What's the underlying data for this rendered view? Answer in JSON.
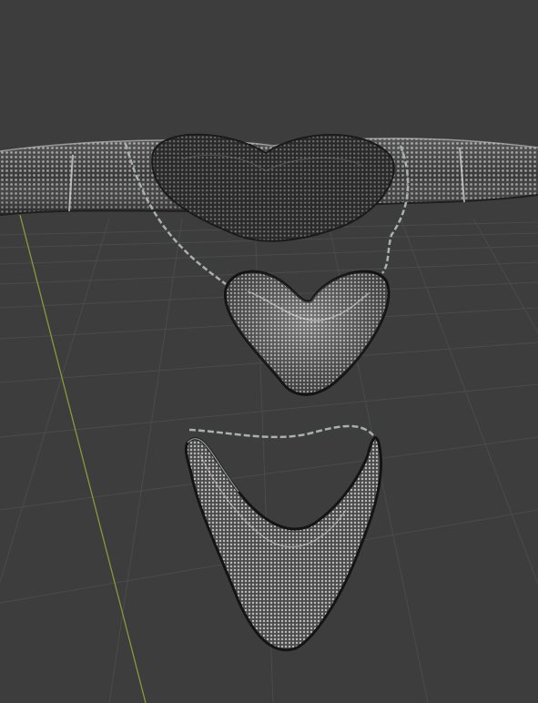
{
  "viewport": {
    "background_color": "#3d3d3d",
    "grid_color": "#4b4b4b",
    "y_axis_color": "#8a9a3a"
  },
  "scene": {
    "objects": [
      {
        "name": "mesh-strap",
        "color": "#8f8f8f"
      },
      {
        "name": "mesh-heart-bra-cup",
        "color": "#5a5a5a"
      },
      {
        "name": "mesh-heart-pendant",
        "color": "#7c7c7c"
      },
      {
        "name": "mesh-bottom-panel",
        "color": "#6a6a6a"
      },
      {
        "name": "chain",
        "color": "#a8b0b0"
      }
    ]
  }
}
